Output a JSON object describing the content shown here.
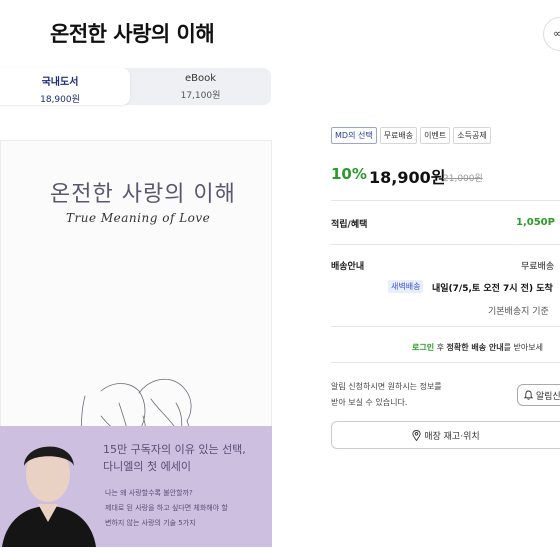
{
  "book": {
    "title": "온전한 사랑의 이해"
  },
  "header": {
    "circle_button_label": "∞"
  },
  "format_tabs": [
    {
      "name": "국내도서",
      "price": "18,900원",
      "active": true
    },
    {
      "name": "eBook",
      "price": "17,100원",
      "active": false
    }
  ],
  "cover": {
    "title": "온전한 사랑의 이해",
    "subtitle": "True Meaning of Love",
    "blurb_line1": "15만 구독자의 이유 있는 선택,",
    "blurb_line2": "다니엘의 첫 에세이",
    "body_line1": "나는 왜 사랑할수록 불안할까?",
    "body_line2": "제대로 된 사랑을 하고 싶다면 체화해야 할",
    "body_line3": "변하지 않는 사랑의 기술 5가지"
  },
  "badges": [
    "MD의 선택",
    "무료배송",
    "이벤트",
    "소득공제"
  ],
  "pricing": {
    "discount": "10%",
    "price": "18,900원",
    "original_price": "21,000원"
  },
  "benefits": {
    "label": "적립/혜택",
    "points": "1,050P"
  },
  "shipping": {
    "label": "배송안내",
    "free": "무료배송",
    "dawn_badge": "새벽배송",
    "delivery_text": "내일(7/5,토 오전 7시 전) 도착",
    "default_address": "기본배송지 기준"
  },
  "login_notice": {
    "link": "로그인",
    "text_before": " 후 ",
    "bold": "정확한 배송 안내",
    "text_after": "를 받아보세"
  },
  "alarm": {
    "line1": "알림 신청하시면 원하시는 정보를",
    "line2": "받아 보실 수 있습니다.",
    "button": "알림신"
  },
  "store_button": "매장 재고·위치",
  "colors": {
    "accent_green": "#2c9a2c",
    "lavender": "#cdbfe0",
    "navy": "#1c2a7a"
  }
}
